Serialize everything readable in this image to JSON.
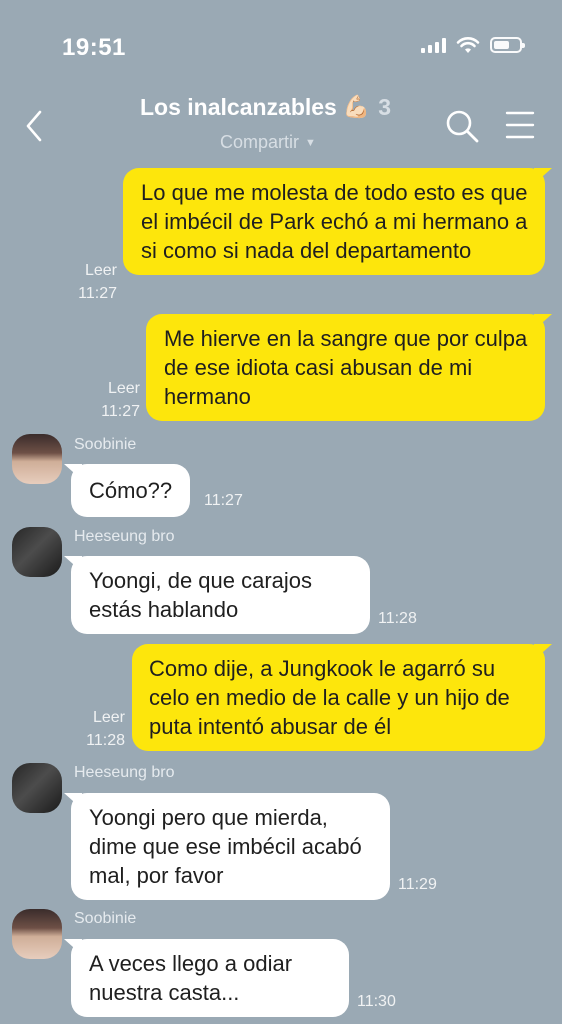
{
  "status_bar": {
    "time": "19:51"
  },
  "header": {
    "title": "Los inalcanzables",
    "emoji": "💪🏻",
    "member_count": "3",
    "share_label": "Compartir"
  },
  "messages": [
    {
      "direction": "outgoing",
      "text": "Lo que me molesta de todo esto es que el imbécil de Park echó a mi hermano a si como si nada del departamento",
      "read": "Leer",
      "time": "11:27"
    },
    {
      "direction": "outgoing",
      "text": "Me hierve en la sangre que por culpa de ese idiota casi abusan de mi hermano",
      "read": "Leer",
      "time": "11:27"
    },
    {
      "direction": "incoming",
      "sender": "Soobinie",
      "text": "Cómo??",
      "time": "11:27"
    },
    {
      "direction": "incoming",
      "sender": "Heeseung bro",
      "text": "Yoongi, de que carajos estás hablando",
      "time": "11:28"
    },
    {
      "direction": "outgoing",
      "text": "Como dije, a Jungkook le agarró su celo en medio de la calle y un hijo de puta intentó abusar de él",
      "read": "Leer",
      "time": "11:28"
    },
    {
      "direction": "incoming",
      "sender": "Heeseung bro",
      "text": "Yoongi pero que mierda, dime que ese imbécil acabó mal, por favor",
      "time": "11:29"
    },
    {
      "direction": "incoming",
      "sender": "Soobinie",
      "text": "A veces llego a odiar nuestra casta...",
      "time": "11:30"
    }
  ]
}
